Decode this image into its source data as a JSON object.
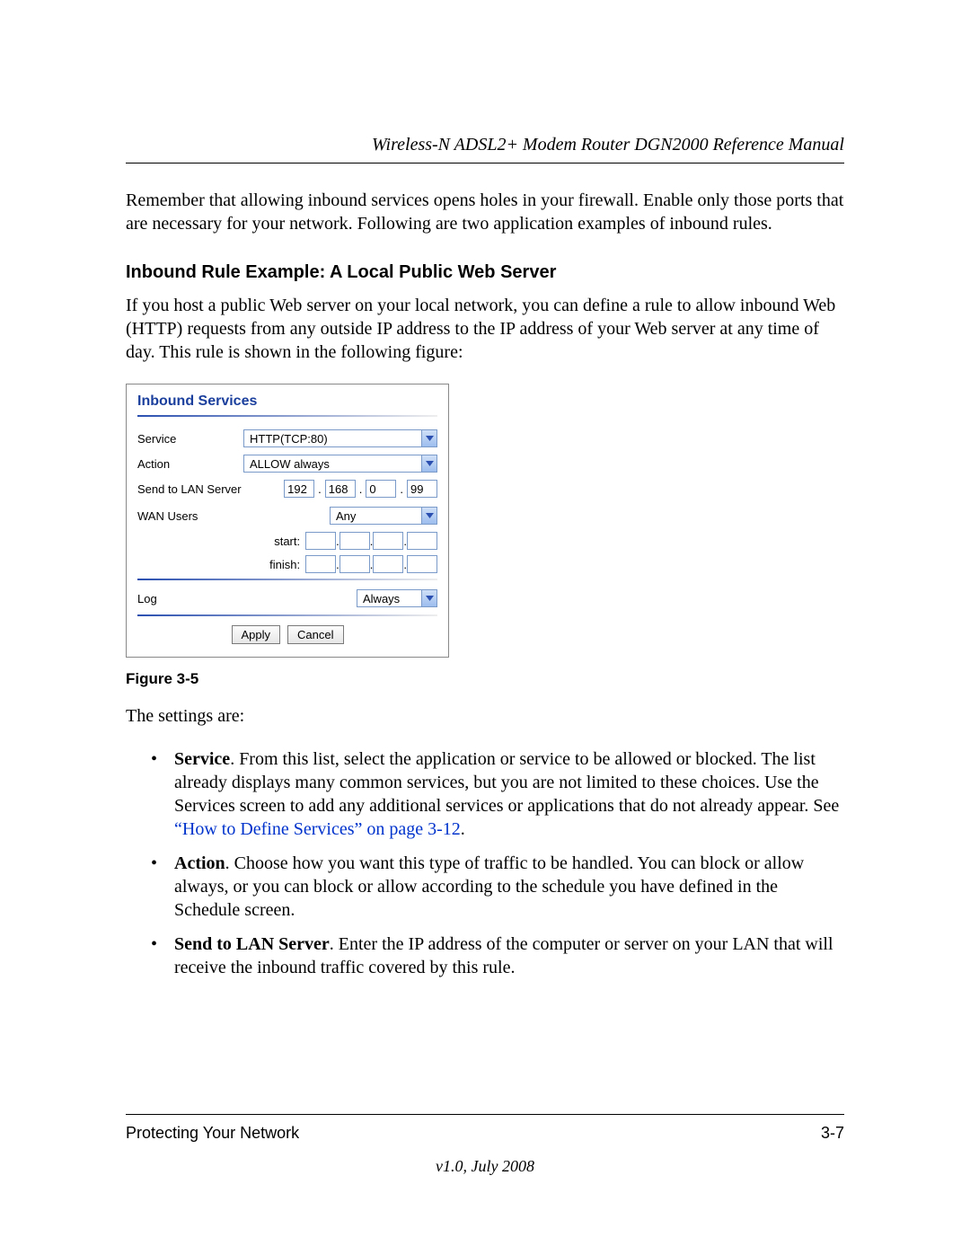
{
  "header": {
    "running_head": "Wireless-N ADSL2+ Modem Router DGN2000 Reference Manual"
  },
  "paragraphs": {
    "intro": "Remember that allowing inbound services opens holes in your firewall. Enable only those ports that are necessary for your network. Following are two application examples of inbound rules.",
    "heading": "Inbound Rule Example: A Local Public Web Server",
    "heading_body": "If you host a public Web server on your local network, you can define a rule to allow inbound Web (HTTP) requests from any outside IP address to the IP address of your Web server at any time of day. This rule is shown in the following figure:",
    "figure_caption": "Figure 3-5",
    "settings_lead": "The settings are:"
  },
  "bullets": {
    "service": {
      "label": "Service",
      "text_before_link": ". From this list, select the application or service to be allowed or blocked. The list already displays many common services, but you are not limited to these choices. Use the Services screen to add any additional services or applications that do not already appear. See ",
      "link": "“How to Define Services” on page 3-12",
      "text_after_link": "."
    },
    "action": {
      "label": "Action",
      "text": ". Choose how you want this type of traffic to be handled. You can block or allow always, or you can block or allow according to the schedule you have defined in the Schedule screen."
    },
    "send": {
      "label": "Send to LAN Server",
      "text": ". Enter the IP address of the computer or server on your LAN that will receive the inbound traffic covered by this rule."
    }
  },
  "router_ui": {
    "title": "Inbound Services",
    "labels": {
      "service": "Service",
      "action": "Action",
      "send_to": "Send to LAN Server",
      "wan_users": "WAN Users",
      "start": "start:",
      "finish": "finish:",
      "log": "Log"
    },
    "values": {
      "service": "HTTP(TCP:80)",
      "action": "ALLOW always",
      "ip": [
        "192",
        "168",
        "0",
        "99"
      ],
      "wan_users": "Any",
      "start": [
        "",
        "",
        "",
        ""
      ],
      "finish": [
        "",
        "",
        "",
        ""
      ],
      "log": "Always"
    },
    "buttons": {
      "apply": "Apply",
      "cancel": "Cancel"
    }
  },
  "footer": {
    "section": "Protecting Your Network",
    "page": "3-7",
    "version": "v1.0, July 2008"
  }
}
